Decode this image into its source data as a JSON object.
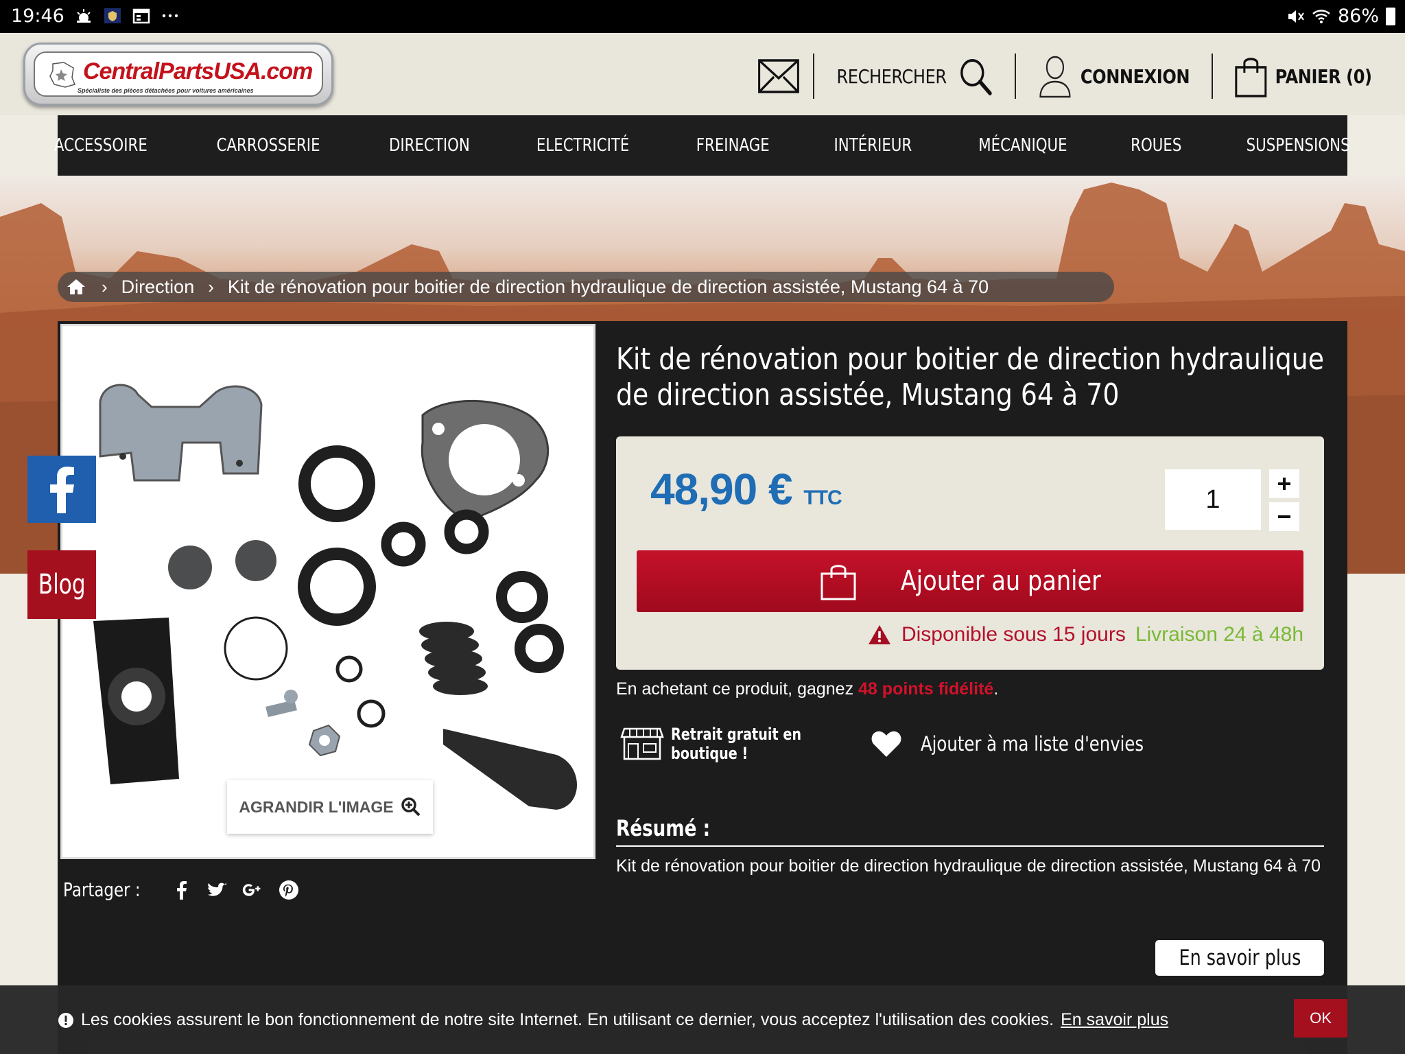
{
  "statusbar": {
    "time": "19:46",
    "battery": "86%"
  },
  "header": {
    "logo_text": "CentralPartsUSA.com",
    "logo_tagline": "Spécialiste des pièces détachées pour voitures américaines",
    "search_label": "RECHERCHER",
    "login_label": "CONNEXION",
    "cart_label": "PANIER (0)"
  },
  "menu": {
    "items": [
      "ACCESSOIRE",
      "CARROSSERIE",
      "DIRECTION",
      "ELECTRICITÉ",
      "FREINAGE",
      "INTÉRIEUR",
      "MÉCANIQUE",
      "ROUES",
      "SUSPENSIONS"
    ]
  },
  "breadcrumb": {
    "category": "Direction",
    "current": "Kit de rénovation pour boitier de direction hydraulique de direction assistée, Mustang 64 à 70"
  },
  "product": {
    "title": "Kit de rénovation pour boitier de direction hydraulique de direction assistée, Mustang 64 à 70",
    "zoom_label": "AGRANDIR L'IMAGE",
    "price": "48,90 €",
    "price_suffix": "TTC",
    "quantity": "1",
    "add_to_cart": "Ajouter au panier",
    "availability": "Disponible sous 15 jours",
    "delivery": "Livraison 24 à 48h",
    "fidelity_prefix": "En achetant ce produit, gagnez",
    "fidelity_points": "48 points fidélité",
    "fidelity_suffix": ".",
    "pickup_label": "Retrait gratuit en boutique !",
    "wishlist_label": "Ajouter à ma liste d'envies",
    "summary_title": "Résumé :",
    "summary_text": "Kit de rénovation pour boitier de direction hydraulique de direction assistée, Mustang 64 à 70",
    "more_label": "En savoir plus"
  },
  "share": {
    "label": "Partager :"
  },
  "sidebar": {
    "blog_label": "Blog"
  },
  "cookie": {
    "text": "Les cookies assurent le bon fonctionnement de notre site Internet. En utilisant ce dernier, vous acceptez l'utilisation des cookies.",
    "link": "En savoir plus",
    "ok": "OK"
  },
  "colors": {
    "price_blue": "#1e6db5",
    "cart_red": "#b10d22",
    "delivery_green": "#79b934",
    "facebook_blue": "#1f5fae"
  }
}
